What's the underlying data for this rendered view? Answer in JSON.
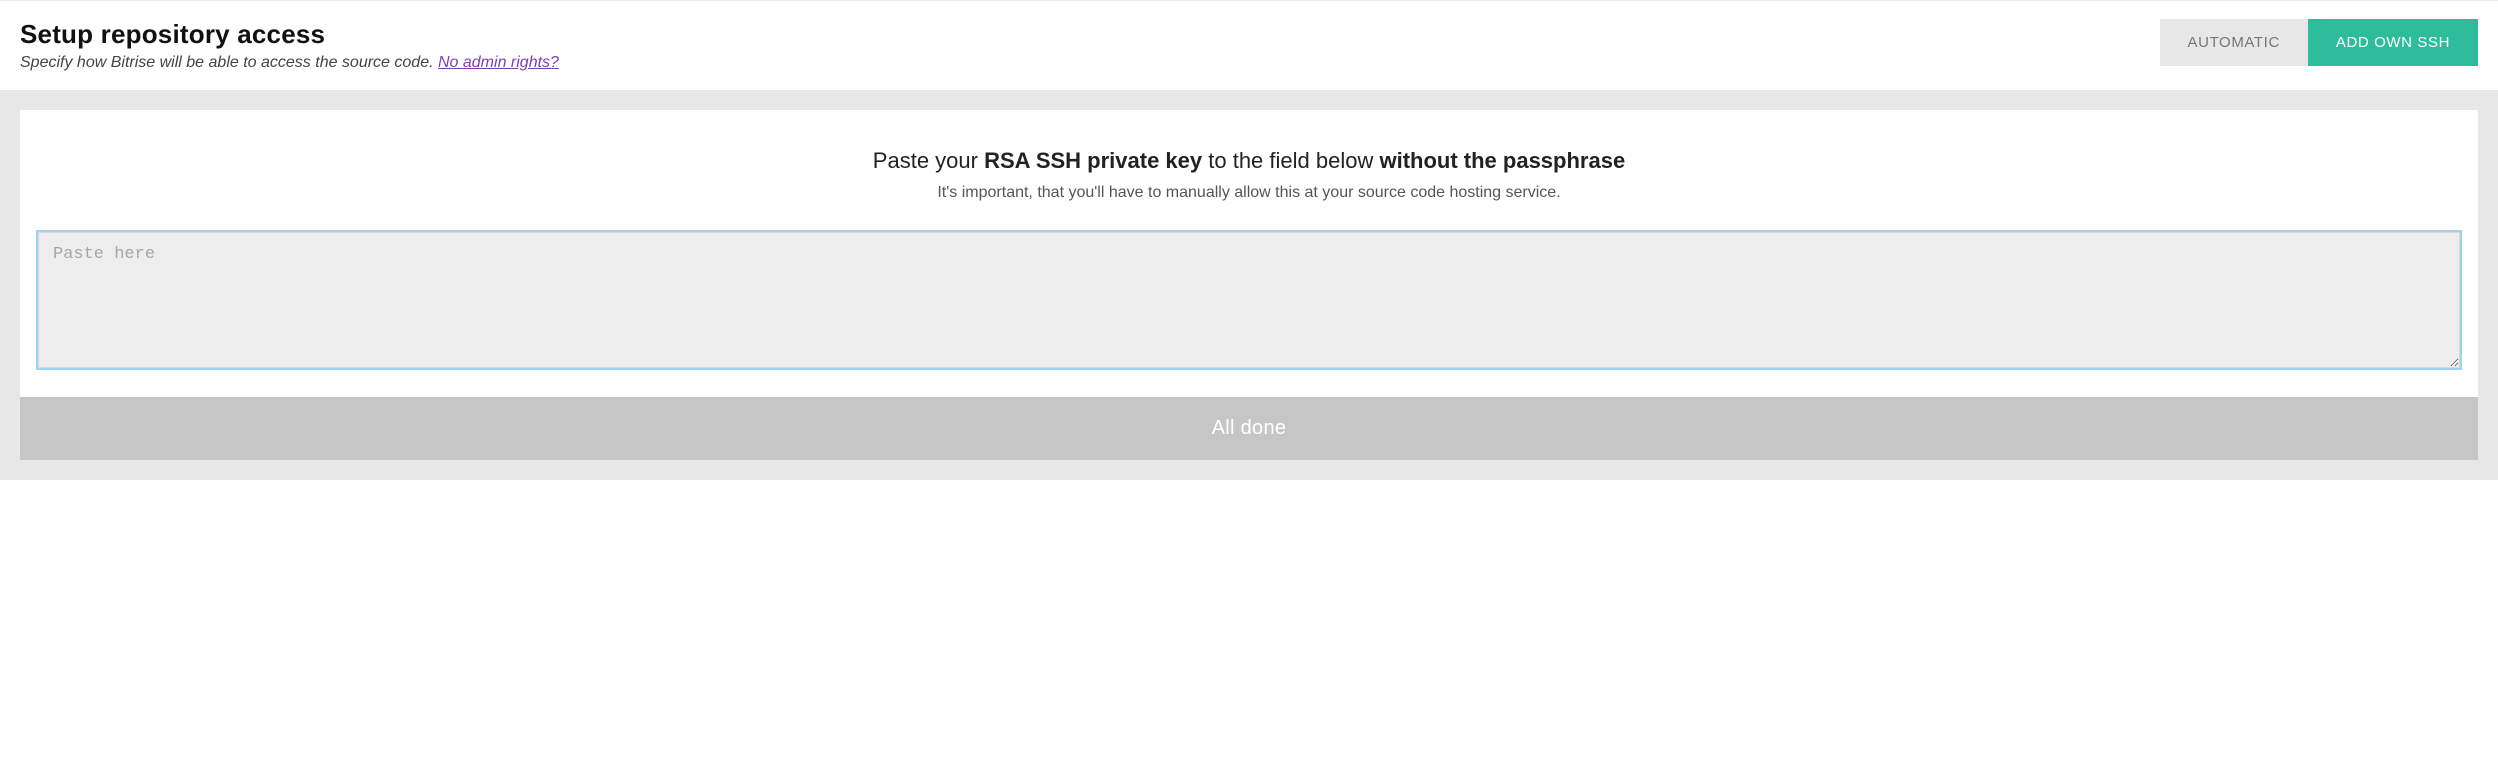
{
  "header": {
    "title": "Setup repository access",
    "subtitle_prefix": "Specify how Bitrise will be able to access the source code. ",
    "subtitle_link": "No admin rights?"
  },
  "tabs": {
    "automatic": "AUTOMATIC",
    "add_own_ssh": "ADD OWN SSH"
  },
  "card": {
    "instruction_prefix": "Paste your ",
    "instruction_bold1": "RSA SSH private key",
    "instruction_mid": " to the field below ",
    "instruction_bold2": "without the passphrase",
    "sub_instruction": "It's important, that you'll have to manually allow this at your source code hosting service.",
    "textarea_placeholder": "Paste here",
    "textarea_value": ""
  },
  "actions": {
    "done_label": "All done"
  }
}
